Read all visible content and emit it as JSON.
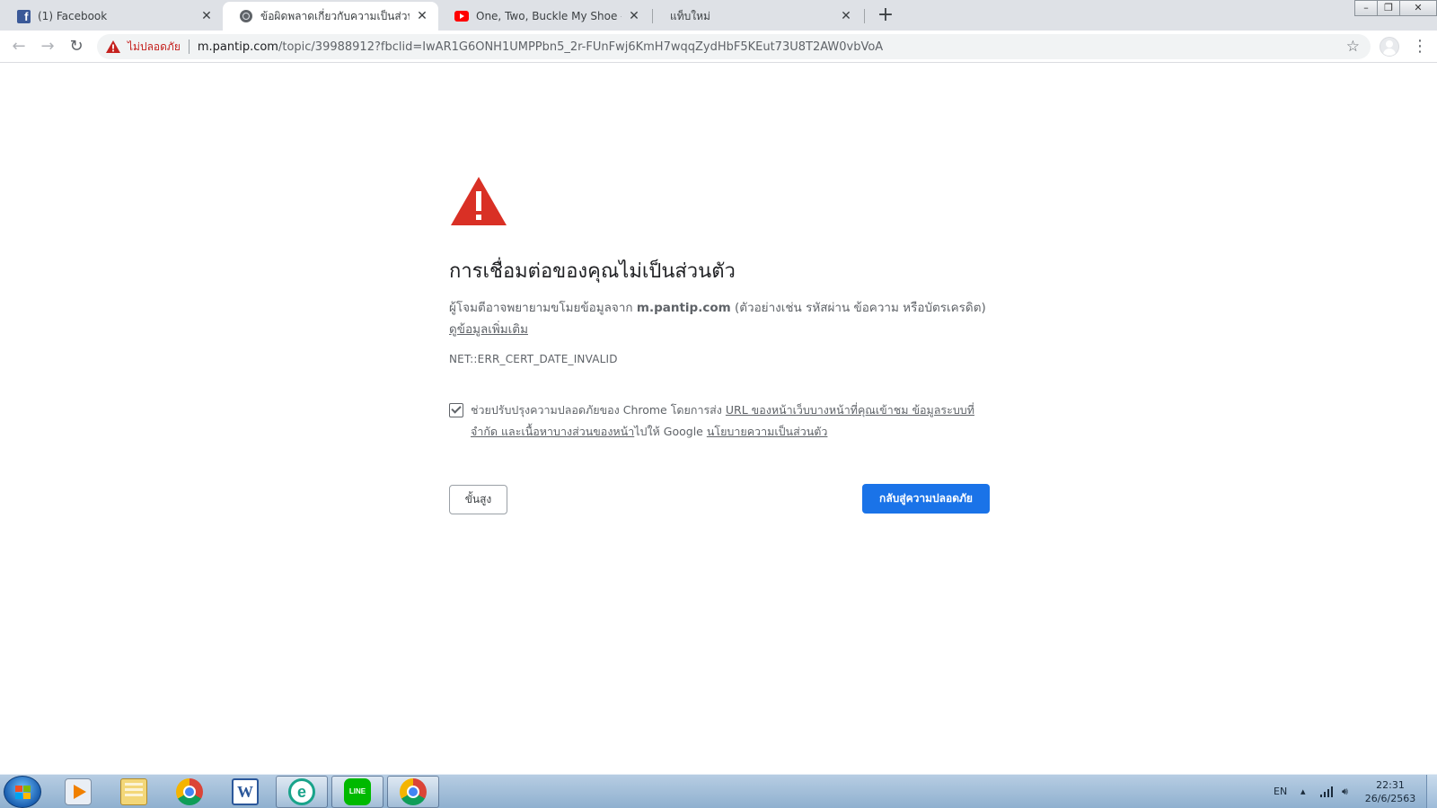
{
  "tabs": [
    {
      "title": "(1) Facebook",
      "icon": "facebook-icon",
      "active": false
    },
    {
      "title": "ข้อผิดพลาดเกี่ยวกับความเป็นส่วนตัว",
      "icon": "globe-icon",
      "active": true
    },
    {
      "title": "One, Two, Buckle My Shoe - The",
      "icon": "youtube-icon",
      "active": false
    },
    {
      "title": "แท็บใหม่",
      "icon": "",
      "active": false
    }
  ],
  "toolbar": {
    "security_label": "ไม่ปลอดภัย",
    "url_host": "m.pantip.com",
    "url_path": "/topic/39988912?fbclid=IwAR1G6ONH1UMPPbn5_2r-FUnFwj6KmH7wqqZydHbF5KEut73U8T2AW0vbVoA"
  },
  "interstitial": {
    "heading": "การเชื่อมต่อของคุณไม่เป็นส่วนตัว",
    "desc_before": "ผู้โจมตีอาจพยายามขโมยข้อมูลจาก ",
    "desc_site": "m.pantip.com",
    "desc_after": " (ตัวอย่างเช่น รหัสผ่าน ข้อความ หรือบัตรเครดิต) ",
    "learn_more": "ดูข้อมูลเพิ่มเติม",
    "error_code": "NET::ERR_CERT_DATE_INVALID",
    "optin_before": "ช่วยปรับปรุงความปลอดภัยของ Chrome โดยการส่ง ",
    "optin_link": "URL ของหน้าเว็บบางหน้าที่คุณเข้าชม ข้อมูลระบบที่จำกัด และเนื้อหาบางส่วนของหน้า",
    "optin_middle": "ไปให้ Google ",
    "optin_policy": "นโยบายความเป็นส่วนตัว",
    "optin_checked": true,
    "advanced_button": "ขั้นสูง",
    "back_button": "กลับสู่ความปลอดภัย"
  },
  "taskbar": {
    "apps": [
      "media-player-icon",
      "file-explorer-icon",
      "chrome-icon",
      "word-icon",
      "eset-icon",
      "line-icon",
      "chrome-icon"
    ],
    "language": "EN",
    "time": "22:31",
    "date": "26/6/2563"
  },
  "colors": {
    "accent": "#1a73e8",
    "warning": "#d93025",
    "tab_strip": "#dee1e6"
  }
}
